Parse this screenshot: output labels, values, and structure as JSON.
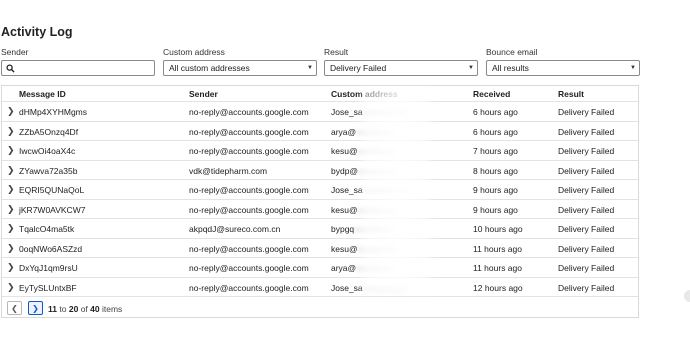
{
  "page": {
    "title": "Activity Log"
  },
  "filters": {
    "sender": {
      "label": "Sender",
      "placeholder": "",
      "value": ""
    },
    "custom_address": {
      "label": "Custom address",
      "value": "All custom addresses"
    },
    "result": {
      "label": "Result",
      "value": "Delivery Failed"
    },
    "bounce_email": {
      "label": "Bounce email",
      "value": "All results"
    }
  },
  "table": {
    "columns": [
      "Message ID",
      "Sender",
      "Custom address",
      "Received",
      "Result"
    ],
    "rows": [
      {
        "id": "dHMp4XYHMgms",
        "sender": "no-reply@accounts.google.com",
        "custom_visible": "Jose_sa",
        "custom_hidden": "xxxxxxxxxx",
        "received": "6 hours ago",
        "result": "Delivery Failed"
      },
      {
        "id": "ZZbA5Onzq4Df",
        "sender": "no-reply@accounts.google.com",
        "custom_visible": "arya@",
        "custom_hidden": "xxxxxxxxx",
        "received": "6 hours ago",
        "result": "Delivery Failed"
      },
      {
        "id": "IwcwOi4oaX4c",
        "sender": "no-reply@accounts.google.com",
        "custom_visible": "kesu@",
        "custom_hidden": "xxxxxxxxx",
        "received": "7 hours ago",
        "result": "Delivery Failed"
      },
      {
        "id": "ZYawva72a35b",
        "sender": "vdk@tidepharm.com",
        "custom_visible": "bydp@",
        "custom_hidden": "xxxxxxxxx",
        "received": "8 hours ago",
        "result": "Delivery Failed"
      },
      {
        "id": "EQRI5QUNaQoL",
        "sender": "no-reply@accounts.google.com",
        "custom_visible": "Jose_sa",
        "custom_hidden": "xxxxxxxxxx",
        "received": "9 hours ago",
        "result": "Delivery Failed"
      },
      {
        "id": "jKR7W0AVKCW7",
        "sender": "no-reply@accounts.google.com",
        "custom_visible": "kesu@",
        "custom_hidden": "xxxxxxxxx",
        "received": "9 hours ago",
        "result": "Delivery Failed"
      },
      {
        "id": "TqalcO4ma5tk",
        "sender": "akpqdJ@sureco.com.cn",
        "custom_visible": "bypgq",
        "custom_hidden": "xxxxxxxxx",
        "received": "10 hours ago",
        "result": "Delivery Failed"
      },
      {
        "id": "0oqNWo6ASZzd",
        "sender": "no-reply@accounts.google.com",
        "custom_visible": "kesu@",
        "custom_hidden": "xxxxxxxxx",
        "received": "11 hours ago",
        "result": "Delivery Failed"
      },
      {
        "id": "DxYqJ1qm9rsU",
        "sender": "no-reply@accounts.google.com",
        "custom_visible": "arya@",
        "custom_hidden": "xxxxxxxxx",
        "received": "11 hours ago",
        "result": "Delivery Failed"
      },
      {
        "id": "EyTySLUntxBF",
        "sender": "no-reply@accounts.google.com",
        "custom_visible": "Jose_sa",
        "custom_hidden": "xxxxxxxxxx",
        "received": "12 hours ago",
        "result": "Delivery Failed"
      }
    ]
  },
  "pagination": {
    "range_start": "11",
    "to_word": "to",
    "range_end": "20",
    "of_word": "of",
    "total": "40",
    "items_word": "items"
  },
  "icons": {
    "search": "search-icon",
    "dropdown": "dropdown-caret-icon",
    "expand": "chevron-right-icon",
    "prev": "chevron-left-icon",
    "next": "chevron-right-icon"
  },
  "colors": {
    "accent": "#0b57d0",
    "border": "#d9d9d9",
    "text": "#222222"
  }
}
